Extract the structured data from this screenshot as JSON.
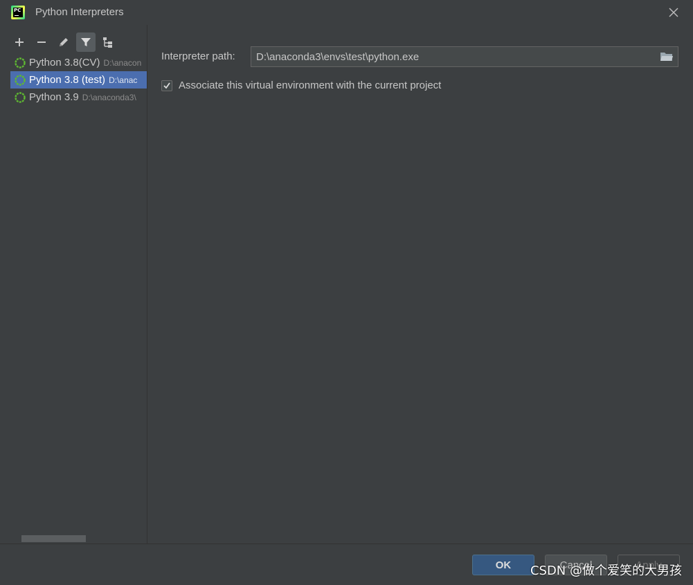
{
  "window": {
    "title": "Python Interpreters",
    "logo_text": "PC",
    "logo_icon": "pycharm-logo-icon",
    "close_icon": "close-icon"
  },
  "toolbar": {
    "buttons": [
      {
        "name": "add-button",
        "icon": "plus-icon",
        "active": false
      },
      {
        "name": "remove-button",
        "icon": "minus-icon",
        "active": false
      },
      {
        "name": "edit-button",
        "icon": "pencil-icon",
        "active": false
      },
      {
        "name": "filter-button",
        "icon": "filter-icon",
        "active": true
      },
      {
        "name": "show-paths-button",
        "icon": "tree-icon",
        "active": false
      }
    ]
  },
  "interpreters": [
    {
      "name": "Python 3.8(CV)",
      "path": "D:\\anacon",
      "selected": false
    },
    {
      "name": "Python 3.8 (test)",
      "path": "D:\\anac",
      "selected": true
    },
    {
      "name": "Python 3.9",
      "path": "D:\\anaconda3\\",
      "selected": false
    }
  ],
  "details": {
    "path_label": "Interpreter path:",
    "path_value": "D:\\anaconda3\\envs\\test\\python.exe",
    "associate_label": "Associate this virtual environment with the current project",
    "associate_checked": true
  },
  "footer": {
    "ok_label": "OK",
    "cancel_label": "Cancel",
    "apply_label": "Apply"
  },
  "watermark": "CSDN @做个爱笑的大男孩",
  "colors": {
    "background": "#3c3f41",
    "selection": "#4b6eaf",
    "ok_button": "#365880",
    "python_icon_green": "#5fb832"
  }
}
